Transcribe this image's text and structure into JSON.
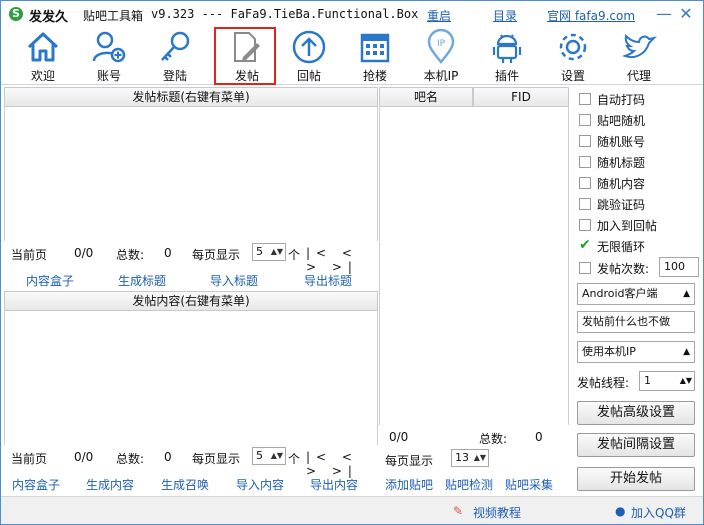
{
  "titlebar": {
    "app_name": "发发久",
    "tool_name": "贴吧工具箱",
    "version": "v9.323 --- FaFa9.TieBa.Functional.Box",
    "restart": "重启",
    "catalog": "目录",
    "official": "官网 fafa9.com",
    "min_glyph": "—",
    "close_glyph": "✕"
  },
  "toolbar": {
    "items": [
      {
        "label": "欢迎",
        "icon": "home-icon"
      },
      {
        "label": "账号",
        "icon": "add-user-icon"
      },
      {
        "label": "登陆",
        "icon": "key-icon"
      },
      {
        "label": "发帖",
        "icon": "edit-doc-icon"
      },
      {
        "label": "回帖",
        "icon": "up-arrow-icon"
      },
      {
        "label": "抢楼",
        "icon": "calendar-icon"
      },
      {
        "label": "本机IP",
        "icon": "location-ip-icon"
      },
      {
        "label": "插件",
        "icon": "android-icon"
      },
      {
        "label": "设置",
        "icon": "gear-icon"
      },
      {
        "label": "代理",
        "icon": "bird-icon"
      }
    ],
    "active_index": 3
  },
  "titles_panel": {
    "header": "发帖标题(右键有菜单)",
    "pager": {
      "current_label": "当前页",
      "current": "0/0",
      "total_label": "总数:",
      "total": "0",
      "per_page_label": "每页显示",
      "per_page": "5",
      "unit": "个",
      "nav": "|< < > >|"
    },
    "links": [
      "内容盒子",
      "生成标题",
      "导入标题",
      "导出标题"
    ]
  },
  "content_panel": {
    "header": "发帖内容(右键有菜单)",
    "pager": {
      "current_label": "当前页",
      "current": "0/0",
      "total_label": "总数:",
      "total": "0",
      "per_page_label": "每页显示",
      "per_page": "5",
      "unit": "个",
      "nav": "|< < > >|"
    },
    "links": [
      "内容盒子",
      "生成内容",
      "生成召唤",
      "导入内容",
      "导出内容"
    ]
  },
  "bar_panel": {
    "col_name": "吧名",
    "col_fid": "FID",
    "current": "0/0",
    "total_label": "总数:",
    "total": "0",
    "per_page_label": "每页显示",
    "per_page": "13",
    "links": [
      "添加贴吧",
      "贴吧检测",
      "贴吧采集"
    ]
  },
  "options": {
    "checks": [
      {
        "label": "自动打码",
        "checked": false
      },
      {
        "label": "贴吧随机",
        "checked": false
      },
      {
        "label": "随机账号",
        "checked": false
      },
      {
        "label": "随机标题",
        "checked": false
      },
      {
        "label": "随机内容",
        "checked": false
      },
      {
        "label": "跳验证码",
        "checked": false
      },
      {
        "label": "加入到回帖",
        "checked": false
      },
      {
        "label": "无限循环",
        "checked": true
      },
      {
        "label": "发帖次数:",
        "checked": false
      }
    ],
    "post_count": "100",
    "client_select": "Android客户端",
    "pre_action_select": "发帖前什么也不做",
    "ip_select": "使用本机IP",
    "threads_label": "发帖线程:",
    "threads": "1",
    "advanced_button": "发帖高级设置",
    "interval_button": "发帖间隔设置",
    "start_button": "开始发帖",
    "check_glyph": "✔",
    "arrow_glyph": "▲"
  },
  "statusbar": {
    "video": "视频教程",
    "qq_group": "加入QQ群"
  },
  "colors": {
    "accent": "#1d5fb3",
    "active_border": "#e2241e",
    "check": "#24a131"
  }
}
